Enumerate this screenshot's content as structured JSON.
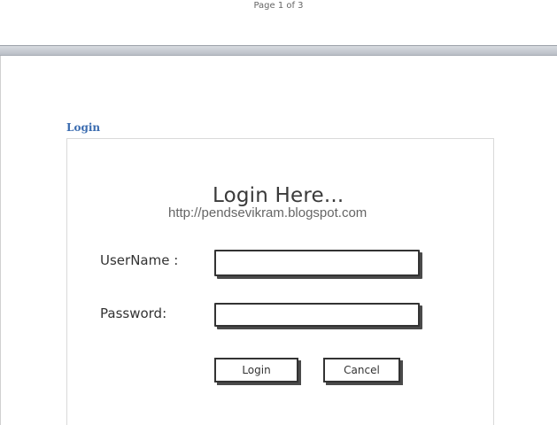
{
  "document": {
    "page_indicator": "Page 1 of 3",
    "section_heading": "Login"
  },
  "mockup": {
    "title": "Login Here...",
    "watermark": "http://pendsevikram.blogspot.com",
    "username_label": "UserName :",
    "password_label": "Password:",
    "username_value": "",
    "password_value": "",
    "login_button": "Login",
    "cancel_button": "Cancel"
  }
}
